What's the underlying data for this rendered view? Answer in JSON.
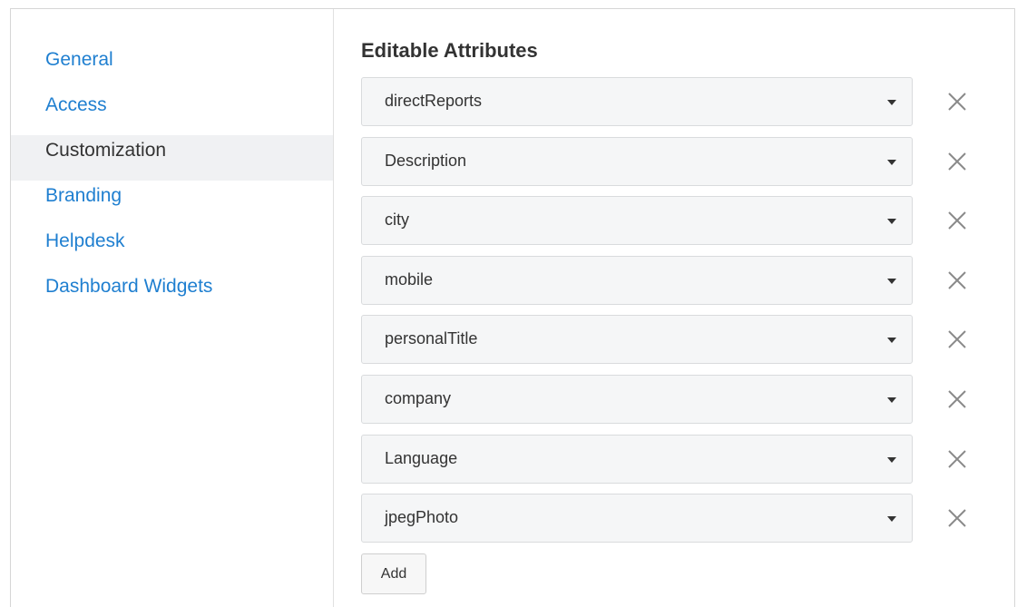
{
  "sidebar": {
    "items": [
      {
        "label": "General",
        "active": false
      },
      {
        "label": "Access",
        "active": false
      },
      {
        "label": "Customization",
        "active": true
      },
      {
        "label": "Branding",
        "active": false
      },
      {
        "label": "Helpdesk",
        "active": false
      },
      {
        "label": "Dashboard Widgets",
        "active": false
      }
    ]
  },
  "main": {
    "title": "Editable Attributes",
    "attributes": [
      {
        "value": "directReports"
      },
      {
        "value": "Description"
      },
      {
        "value": "city"
      },
      {
        "value": "mobile"
      },
      {
        "value": "personalTitle"
      },
      {
        "value": "company"
      },
      {
        "value": "Language"
      },
      {
        "value": "jpegPhoto"
      }
    ],
    "add_label": "Add"
  },
  "icons": {
    "dropdown": "caret-down-icon",
    "remove": "close-icon"
  },
  "colors": {
    "link": "#1f7fd0",
    "active_bg": "#f0f1f3",
    "text": "#333333",
    "select_bg": "#f5f6f7"
  }
}
